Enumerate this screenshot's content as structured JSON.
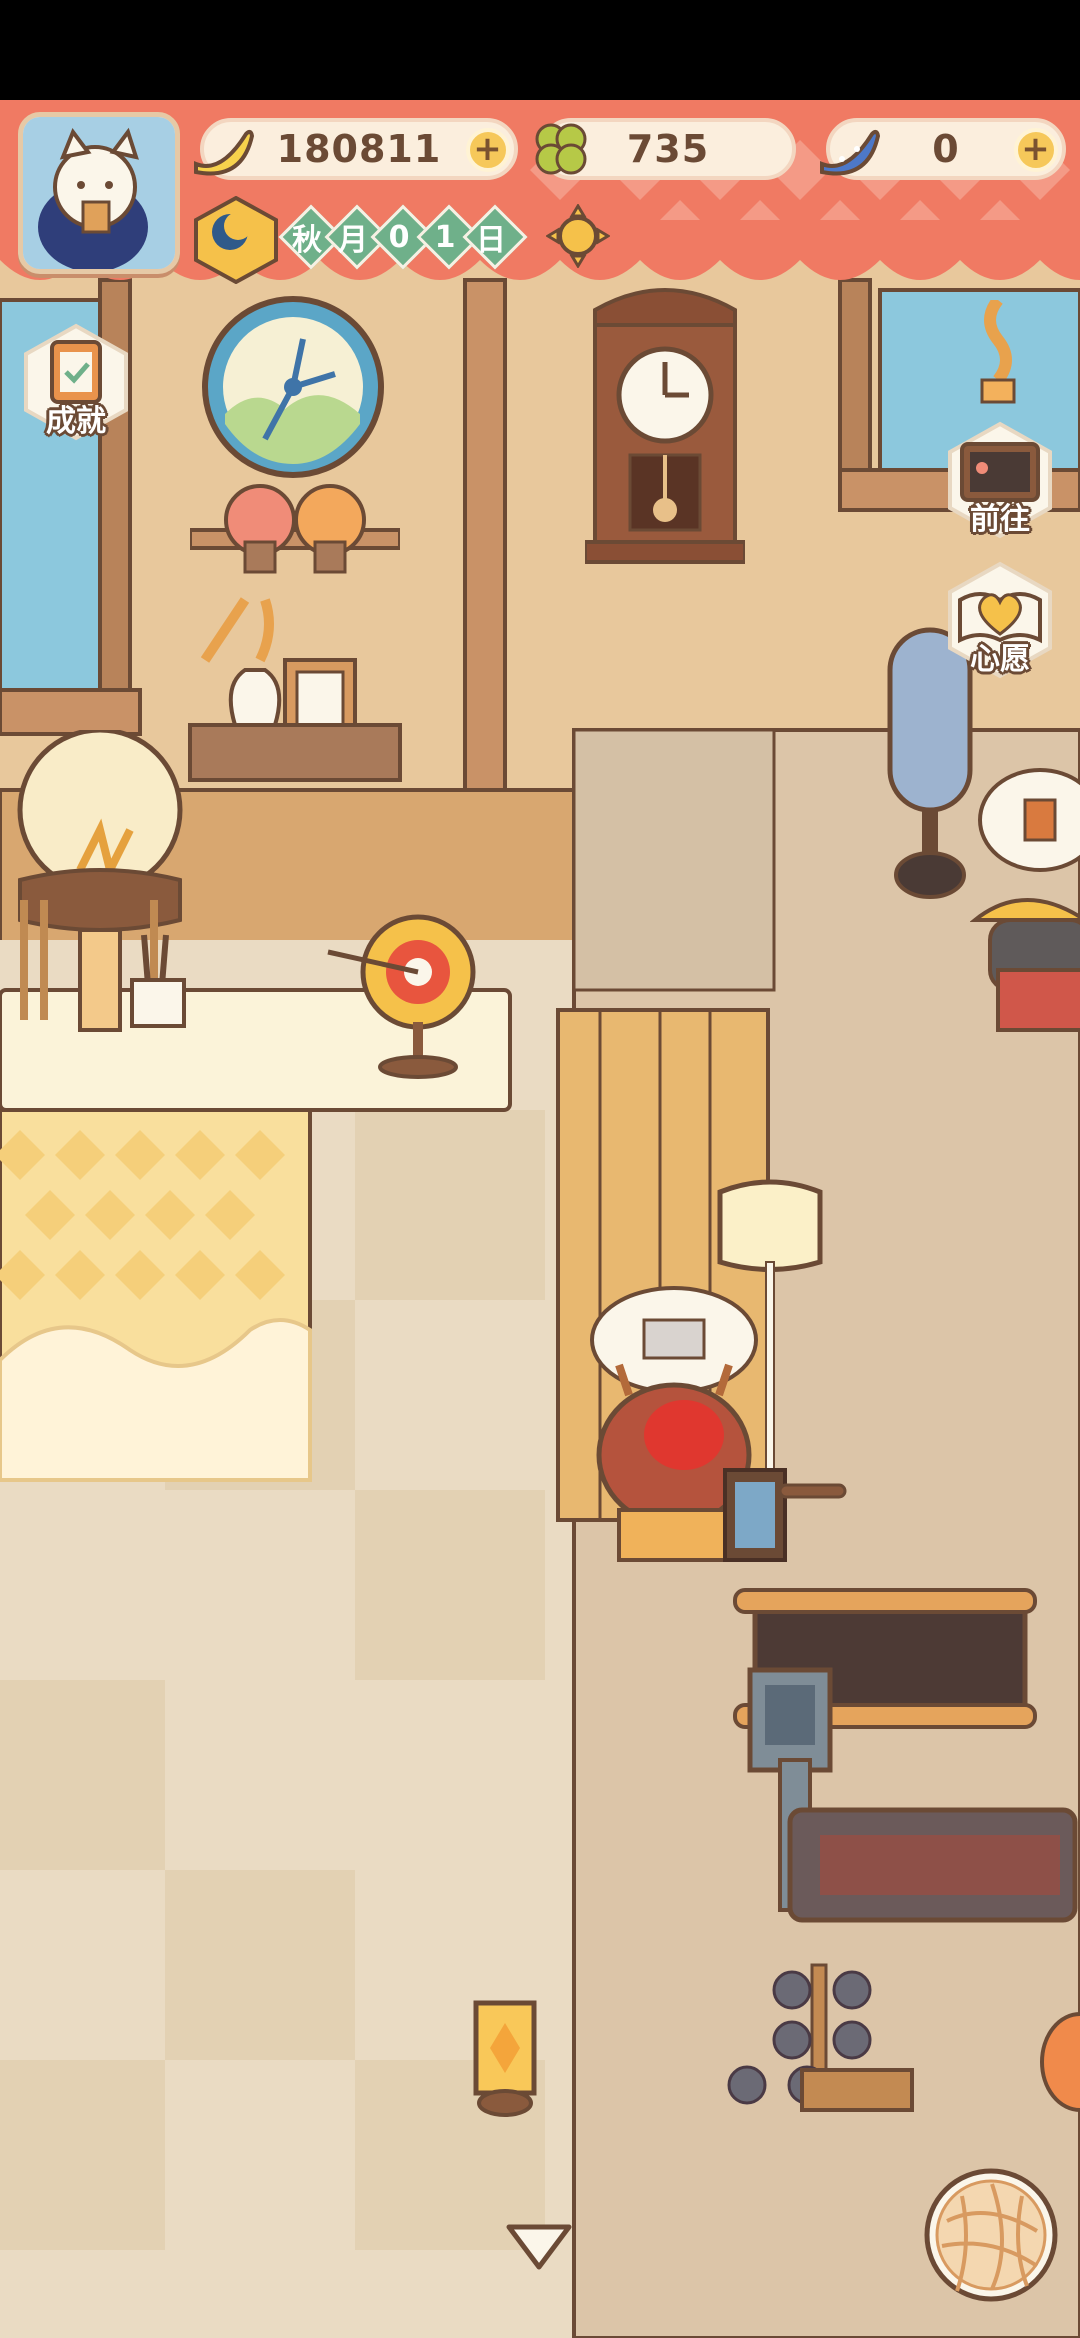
{
  "hud": {
    "currencies": [
      {
        "name": "banana",
        "value": "180811",
        "icon": "banana-icon",
        "has_plus": true
      },
      {
        "name": "clover",
        "value": "735",
        "icon": "clover-icon",
        "has_plus": false
      },
      {
        "name": "blue-banana",
        "value": "0",
        "icon": "blue-banana-icon",
        "has_plus": true
      }
    ],
    "date": {
      "season": "秋",
      "month": "月",
      "day_digits": [
        "0",
        "1"
      ],
      "day_unit": "日",
      "weather_icon": "sun-icon",
      "time_icon": "moon-icon"
    },
    "avatar_icon": "cat-avatar-icon"
  },
  "side_buttons": {
    "achievement": {
      "label": "成就",
      "icon": "clipboard-icon"
    },
    "goto": {
      "label": "前往",
      "icon": "signboard-icon"
    },
    "wish": {
      "label": "心愿",
      "icon": "heart-book-icon"
    }
  },
  "bottom": {
    "arrow_icon": "down-triangle-icon",
    "yarn_icon": "yarn-ball-icon"
  },
  "colors": {
    "wall": "#e8c89c",
    "floor": "#eadbc3",
    "awning_red": "#f07a63",
    "awning_light": "#f6a38f",
    "outline": "#6b4a35",
    "gym_floor": "#dcc5a8"
  }
}
